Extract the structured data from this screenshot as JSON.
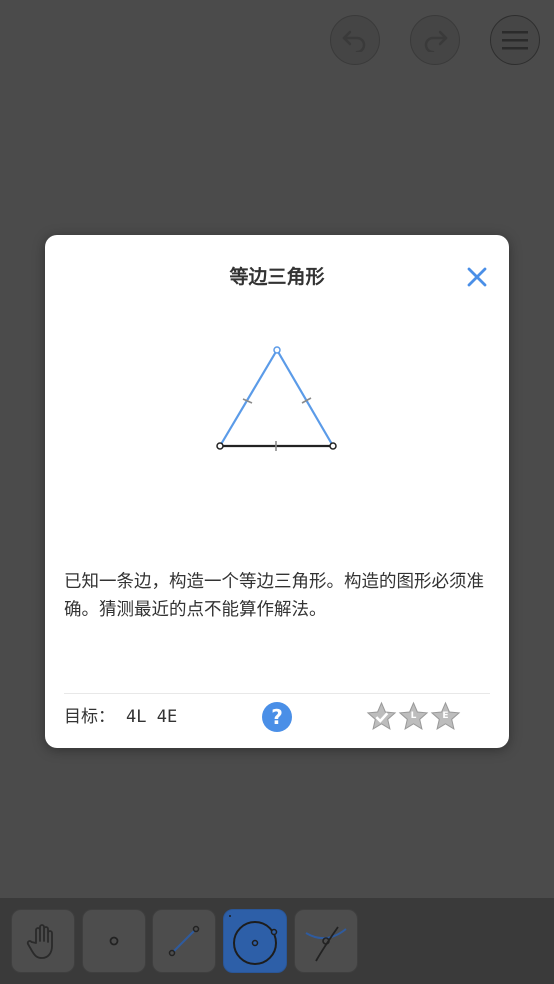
{
  "header": {
    "undo_icon": "undo-icon",
    "redo_icon": "redo-icon",
    "menu_icon": "menu-icon"
  },
  "dialog": {
    "title": "等边三角形",
    "description": "已知一条边，构造一个等边三角形。构造的图形必须准确。猜测最近的点不能算作解法。",
    "goal_label": "目标：",
    "goal_value": "4L 4E",
    "help_label": "?",
    "stars": [
      {
        "label": "",
        "icon": "star-icon"
      },
      {
        "label": "L",
        "icon": "star-icon"
      },
      {
        "label": "E",
        "icon": "star-icon"
      }
    ],
    "colors": {
      "accent": "#4a8fe7",
      "star": "#bdbdbd",
      "text": "#333333"
    }
  },
  "toolbar": {
    "tools": [
      {
        "name": "hand",
        "icon": "hand-icon"
      },
      {
        "name": "point",
        "icon": "point-icon"
      },
      {
        "name": "line",
        "icon": "line-icon"
      },
      {
        "name": "circle",
        "icon": "circle-icon",
        "active": true
      },
      {
        "name": "intersect",
        "icon": "intersect-icon"
      }
    ]
  }
}
